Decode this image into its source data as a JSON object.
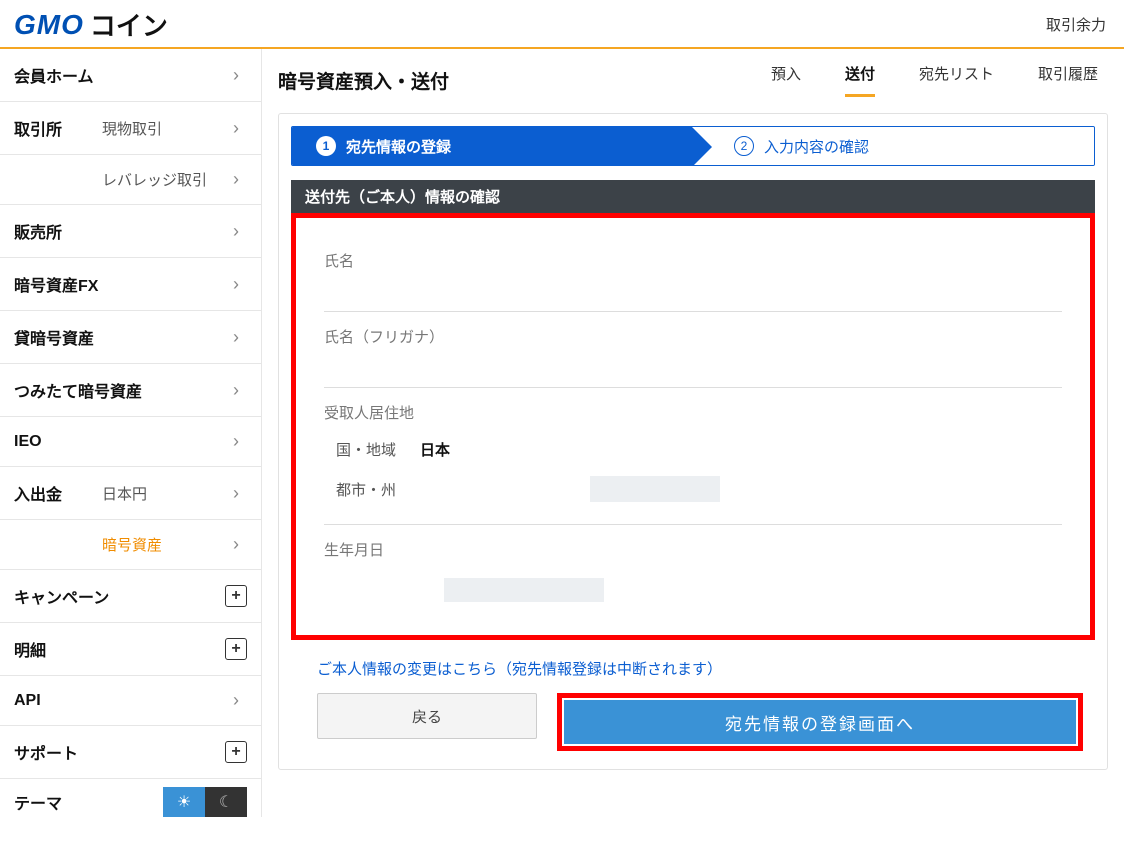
{
  "header": {
    "logo_gmo": "GMO",
    "logo_coin": "コイン",
    "right_label": "取引余力"
  },
  "sidebar": {
    "items": [
      {
        "label": "会員ホーム",
        "sub": "",
        "icon": "chevron"
      },
      {
        "label": "取引所",
        "sub": "現物取引",
        "icon": "chevron"
      },
      {
        "label": "",
        "sub": "レバレッジ取引",
        "icon": "chevron"
      },
      {
        "label": "販売所",
        "sub": "",
        "icon": "chevron"
      },
      {
        "label": "暗号資産FX",
        "sub": "",
        "icon": "chevron"
      },
      {
        "label": "貸暗号資産",
        "sub": "",
        "icon": "chevron"
      },
      {
        "label": "つみたて暗号資産",
        "sub": "",
        "icon": "chevron"
      },
      {
        "label": "IEO",
        "sub": "",
        "icon": "chevron"
      },
      {
        "label": "入出金",
        "sub": "日本円",
        "icon": "chevron"
      },
      {
        "label": "",
        "sub": "暗号資産",
        "icon": "chevron",
        "active": true
      },
      {
        "label": "キャンペーン",
        "sub": "",
        "icon": "plus"
      },
      {
        "label": "明細",
        "sub": "",
        "icon": "plus"
      },
      {
        "label": "API",
        "sub": "",
        "icon": "chevron"
      },
      {
        "label": "サポート",
        "sub": "",
        "icon": "plus"
      }
    ],
    "theme_label": "テーマ"
  },
  "main": {
    "title": "暗号資産預入・送付",
    "tabs": [
      "預入",
      "送付",
      "宛先リスト",
      "取引履歴"
    ],
    "selected_tab": "送付",
    "stepper": {
      "step1": "宛先情報の登録",
      "step2": "入力内容の確認",
      "num1": "1",
      "num2": "2"
    },
    "section_title": "送付先（ご本人）情報の確認",
    "fields": {
      "name_label": "氏名",
      "kana_label": "氏名（フリガナ）",
      "residence_label": "受取人居住地",
      "country_label": "国・地域",
      "country_value": "日本",
      "city_label": "都市・州",
      "birth_label": "生年月日"
    },
    "note_link": "ご本人情報の変更はこちら（宛先情報登録は中断されます）",
    "back_button": "戻る",
    "primary_button": "宛先情報の登録画面へ"
  }
}
